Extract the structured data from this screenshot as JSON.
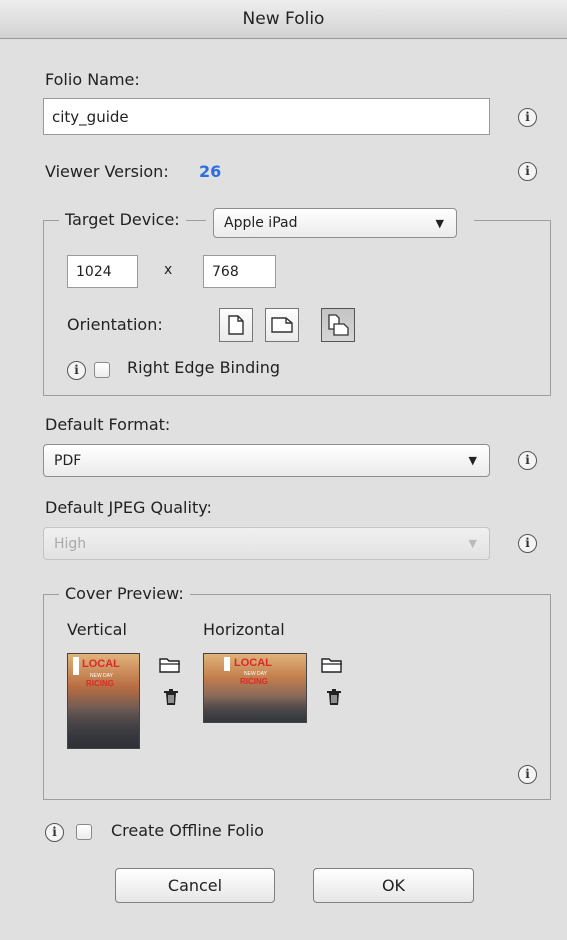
{
  "dialog": {
    "title": "New Folio"
  },
  "folio_name": {
    "label": "Folio Name:",
    "value": "city_guide"
  },
  "viewer": {
    "label": "Viewer Version:",
    "value": "26",
    "value_color": "#2a6ee0"
  },
  "target": {
    "label": "Target Device:",
    "selected": "Apple iPad",
    "width": "1024",
    "times": "x",
    "height": "768",
    "orientation_label": "Orientation:",
    "binding_label": "Right Edge Binding"
  },
  "format": {
    "label": "Default Format:",
    "selected": "PDF"
  },
  "jpeg": {
    "label": "Default JPEG Quality:",
    "selected": "High"
  },
  "cover": {
    "label": "Cover Preview:",
    "vertical": "Vertical",
    "horizontal": "Horizontal",
    "thumb_text": "LOCAL",
    "thumb_subtext": "NEW DAY",
    "thumb_subtext2": "RICING"
  },
  "offline": {
    "label": "Create Offline Folio"
  },
  "buttons": {
    "cancel": "Cancel",
    "ok": "OK"
  },
  "icons": {
    "info": "i",
    "dropdown": "▼"
  }
}
